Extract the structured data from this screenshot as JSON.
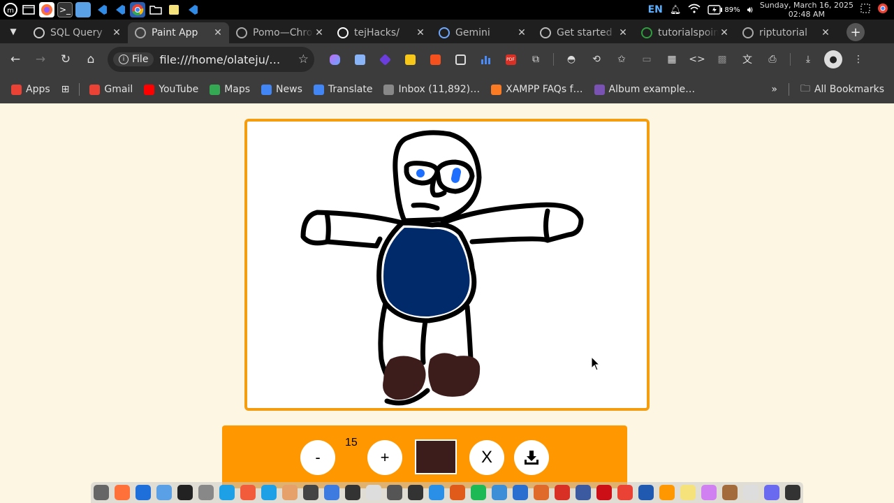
{
  "system": {
    "language": "EN",
    "date": "Sunday, March 16, 2025",
    "time": "02:48 AM",
    "battery": "89%",
    "taskbar_icons": [
      "mint-menu-icon",
      "window-icon",
      "firefox-icon",
      "terminal-icon",
      "files-icon",
      "vscode-icon",
      "vscode-icon",
      "chrome-icon",
      "folder-icon",
      "notes-icon",
      "vscode-icon"
    ]
  },
  "tabs": [
    {
      "title": "SQL Query",
      "favicon": "openai-icon",
      "color": "#cccccc"
    },
    {
      "title": "Paint App",
      "favicon": "globe-icon",
      "color": "#aaaaaa",
      "active": true
    },
    {
      "title": "Pomo—Chrome",
      "favicon": "globe-icon",
      "color": "#aaaaaa"
    },
    {
      "title": "tejHacks/",
      "favicon": "github-icon",
      "color": "#ffffff"
    },
    {
      "title": "Gemini",
      "favicon": "gemini-icon",
      "color": "#6fa8ff"
    },
    {
      "title": "Get started",
      "favicon": "cursor-icon",
      "color": "#bbbbbb"
    },
    {
      "title": "tutorialspoint",
      "favicon": "tutorialspoint-icon",
      "color": "#2e9e3e"
    },
    {
      "title": "riptutorial",
      "favicon": "globe-icon",
      "color": "#aaaaaa"
    }
  ],
  "toolbar": {
    "file_chip": "File",
    "url": "file:///home/olateju/…"
  },
  "bookmarks": [
    {
      "label": "Apps",
      "icon": "apps-grid-icon",
      "color": "#ea4335"
    },
    {
      "label": "Gmail",
      "icon": "gmail-icon",
      "color": "#ea4335"
    },
    {
      "label": "YouTube",
      "icon": "youtube-icon",
      "color": "#ff0000"
    },
    {
      "label": "Maps",
      "icon": "maps-icon",
      "color": "#34a853"
    },
    {
      "label": "News",
      "icon": "news-icon",
      "color": "#4285f4"
    },
    {
      "label": "Translate",
      "icon": "translate-icon",
      "color": "#4285f4"
    },
    {
      "label": "Inbox (11,892)…",
      "icon": "globe-icon",
      "color": "#888888"
    },
    {
      "label": "XAMPP FAQs f…",
      "icon": "xampp-icon",
      "color": "#fb7a24"
    },
    {
      "label": "Album example…",
      "icon": "bootstrap-icon",
      "color": "#7952b3"
    }
  ],
  "all_bookmarks": "All Bookmarks",
  "paint": {
    "brush_size": "15",
    "decrease_label": "-",
    "increase_label": "+",
    "clear_label": "X",
    "current_color": "#3d1c1c",
    "canvas_bg": "#ffffff",
    "frame_color": "#f59d10",
    "panel_color": "#ff9800"
  },
  "dock_icons": [
    "shortcut-icon",
    "firefox-icon",
    "bitwarden-icon",
    "files-icon",
    "terminal-icon",
    "launcher-icon",
    "search-icon",
    "music-icon",
    "media-icon",
    "hexchat-icon",
    "screen-icon",
    "notes-icon",
    "network-icon",
    "tux-icon",
    "screenshot-icon",
    "git-icon",
    "appstore-icon",
    "installer-icon",
    "spotify-icon",
    "inkscape-icon",
    "writer-icon",
    "impress-icon",
    "pdf-icon",
    "archive-icon",
    "opera-icon",
    "chrome-icon",
    "vscode-icon",
    "sublime-icon",
    "sticky-icon",
    "draw-icon",
    "gimp-icon",
    "pen-icon",
    "image-icon",
    "clock-icon"
  ]
}
